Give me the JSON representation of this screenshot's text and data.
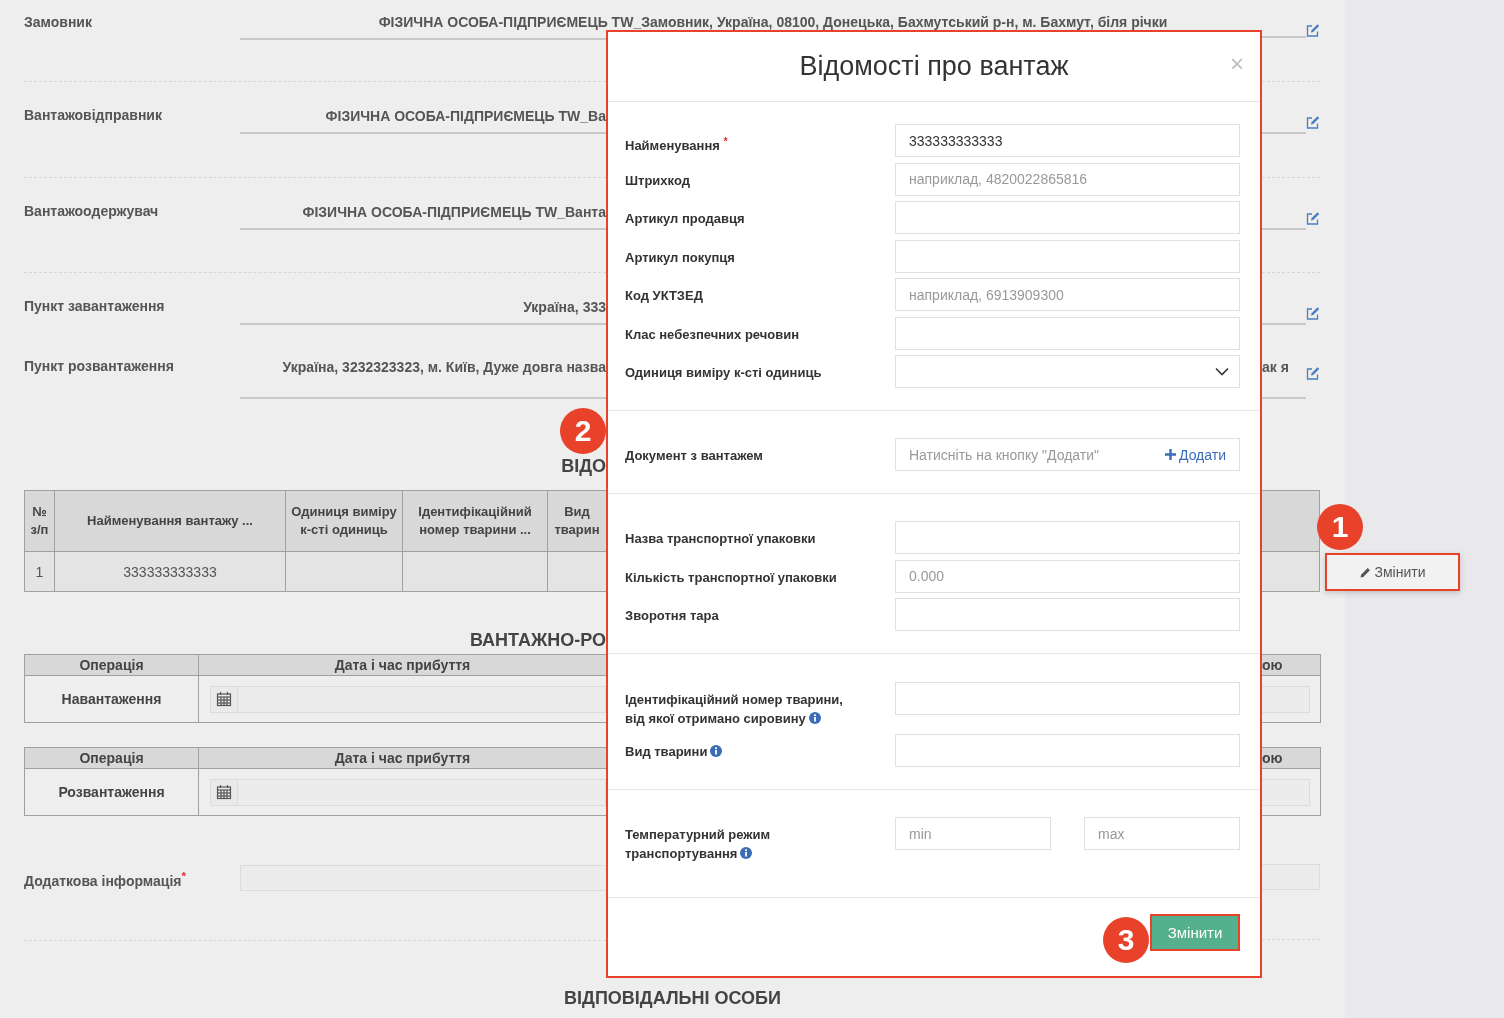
{
  "form_rows": [
    {
      "label": "Замовник",
      "value": "ФІЗИЧНА ОСОБА-ПІДПРИЄМЕЦЬ TW_Замовник, Україна, 08100, Донецька, Бахмутський р-н, м. Бахмут, біля річки"
    },
    {
      "label": "Вантажовідправник",
      "value": "ФІЗИЧНА ОСОБА-ПІДПРИЄМЕЦЬ TW_Ва"
    },
    {
      "label": "Вантажоодержувач",
      "value": "ФІЗИЧНА ОСОБА-ПІДПРИЄМЕЦЬ TW_Ванта"
    },
    {
      "label": "Пункт завантаження",
      "value": "Україна, 333"
    },
    {
      "label": "Пункт розвантаження",
      "value": "Україна, 3232323323, м. Київ, Дуже довга назва",
      "value_end": "ак я"
    }
  ],
  "cargo_section": {
    "title": "ВІДО",
    "columns": [
      "№ з/п",
      "Найменування вантажу ...",
      "Одиниця виміру к-сті одиниць",
      "Ідентифікаційний номер тварини ...",
      "Вид тварин"
    ],
    "rows": [
      {
        "number": "1",
        "name": "333333333333"
      }
    ]
  },
  "popup_button": {
    "label": "Змінити"
  },
  "operations_section": {
    "title": "ВАНТАЖНО-РО",
    "tables": [
      {
        "columns": [
          "Операція",
          "Дата і час прибуття"
        ],
        "column_end": "ою",
        "operation": "Навантаження"
      },
      {
        "columns": [
          "Операція",
          "Дата і час прибуття"
        ],
        "column_end": "ою",
        "operation": "Розвантаження"
      }
    ]
  },
  "additional_info": {
    "label": "Додаткова інформація$^{*}$"
  },
  "responsible_section": {
    "title": "ВІДПОВІДАЛЬНІ ОСОБИ"
  },
  "modal": {
    "title": "Відомості про вантаж",
    "close": "×",
    "submit": "Змінити",
    "sections": [
      {
        "fields": [
          {
            "kind": "text",
            "label": "Найменування $^{*}$",
            "value": "333333333333"
          },
          {
            "kind": "text",
            "label": "Штрихкод",
            "placeholder": "наприклад, 4820022865816"
          },
          {
            "kind": "text",
            "label": "Артикул продавця"
          },
          {
            "kind": "text",
            "label": "Артикул покупця"
          },
          {
            "kind": "text",
            "label": "Код УКТЗЕД",
            "placeholder": "наприклад, 6913909300"
          },
          {
            "kind": "text",
            "label": "Клас небезпечних речовин"
          },
          {
            "kind": "select",
            "label": "Одиниця виміру к-сті одиниць"
          }
        ]
      },
      {
        "fields": [
          {
            "kind": "document",
            "label": "Документ з вантажем",
            "placeholder": "Натисніть на кнопку \"Додати\"",
            "action": "Додати"
          }
        ]
      },
      {
        "fields": [
          {
            "kind": "text",
            "label": "Назва транспортної упаковки"
          },
          {
            "kind": "text",
            "label": "Кількість транспортної упаковки",
            "placeholder": "0.000"
          },
          {
            "kind": "text",
            "label": "Зворотня тара"
          }
        ]
      },
      {
        "fields": [
          {
            "kind": "text",
            "label": "Ідентифікаційний номер тварини, від якої отримано сировину",
            "info": true
          },
          {
            "kind": "text",
            "label": "Вид тварини",
            "info": true
          }
        ]
      },
      {
        "fields": [
          {
            "kind": "range",
            "label": "Температурний режим транспортування",
            "info": true,
            "placeholder_min": "min",
            "placeholder_max": "max"
          }
        ]
      }
    ]
  },
  "callouts": [
    "1",
    "2",
    "3"
  ]
}
